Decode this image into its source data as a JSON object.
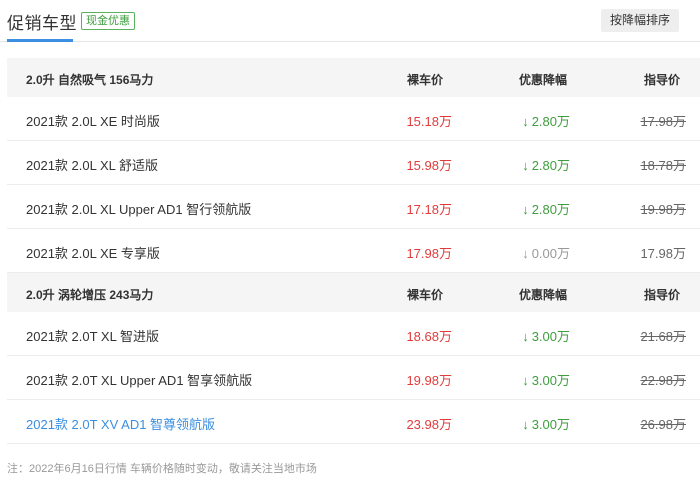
{
  "header": {
    "title": "促销车型",
    "badge": "现金优惠",
    "sort_button": "按降幅排序"
  },
  "groups": [
    {
      "engine": "2.0升 自然吸气 156马力",
      "col_price": "裸车价",
      "col_discount": "优惠降幅",
      "col_guide": "指导价",
      "rows": [
        {
          "name": "2021款 2.0L XE 时尚版",
          "price": "15.18万",
          "arrow": "↓",
          "discount": "2.80万",
          "guide": "17.98万"
        },
        {
          "name": "2021款 2.0L XL 舒适版",
          "price": "15.98万",
          "arrow": "↓",
          "discount": "2.80万",
          "guide": "18.78万"
        },
        {
          "name": "2021款 2.0L XL Upper AD1 智行领航版",
          "price": "17.18万",
          "arrow": "↓",
          "discount": "2.80万",
          "guide": "19.98万"
        },
        {
          "name": "2021款 2.0L XE 专享版",
          "price": "17.98万",
          "arrow": "↓",
          "discount": "0.00万",
          "guide": "17.98万"
        }
      ]
    },
    {
      "engine": "2.0升 涡轮增压 243马力",
      "col_price": "裸车价",
      "col_discount": "优惠降幅",
      "col_guide": "指导价",
      "rows": [
        {
          "name": "2021款 2.0T XL 智进版",
          "price": "18.68万",
          "arrow": "↓",
          "discount": "3.00万",
          "guide": "21.68万"
        },
        {
          "name": "2021款 2.0T XL Upper AD1 智享领航版",
          "price": "19.98万",
          "arrow": "↓",
          "discount": "3.00万",
          "guide": "22.98万"
        },
        {
          "name": "2021款 2.0T XV AD1 智尊领航版",
          "price": "23.98万",
          "arrow": "↓",
          "discount": "3.00万",
          "guide": "26.98万"
        }
      ]
    }
  ],
  "footnote": "注：2022年6月16日行情 车辆价格随时变动，敬请关注当地市场",
  "colors": {
    "accent": "#3b8fe0",
    "price": "#e03c3c",
    "discount": "#3e9e3e",
    "muted": "#999999"
  }
}
